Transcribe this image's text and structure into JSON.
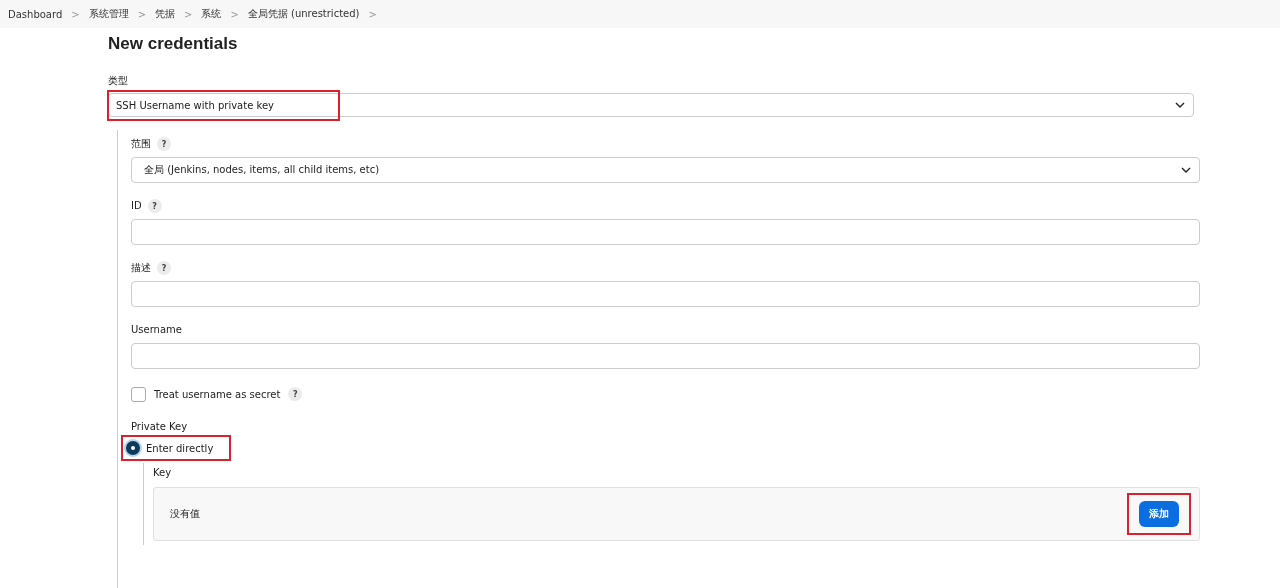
{
  "breadcrumb": [
    {
      "label": "Dashboard"
    },
    {
      "label": "系统管理"
    },
    {
      "label": "凭据"
    },
    {
      "label": "系统"
    },
    {
      "label": "全局凭据 (unrestricted)"
    }
  ],
  "breadcrumb_separator": ">",
  "title": "New credentials",
  "type_field": {
    "label": "类型",
    "value": "SSH Username with private key",
    "highlighted": true
  },
  "fields": [
    {
      "kind": "select",
      "label": "范围",
      "help": "?",
      "value": "全局 (Jenkins, nodes, items, all child items, etc)"
    },
    {
      "kind": "text",
      "label": "ID",
      "help": "?"
    },
    {
      "kind": "text",
      "label": "描述",
      "help": "?"
    },
    {
      "kind": "text",
      "label": "Username"
    },
    {
      "kind": "checkbox",
      "label": "Treat username as secret",
      "help": "?",
      "checked": false
    }
  ],
  "private_key": {
    "label": "Private Key",
    "options": [
      {
        "label": "Enter directly",
        "selected": true,
        "highlighted": true
      }
    ],
    "key": {
      "label": "Key",
      "value_text": "没有值",
      "button": {
        "label": "添加",
        "highlighted": true
      }
    }
  }
}
